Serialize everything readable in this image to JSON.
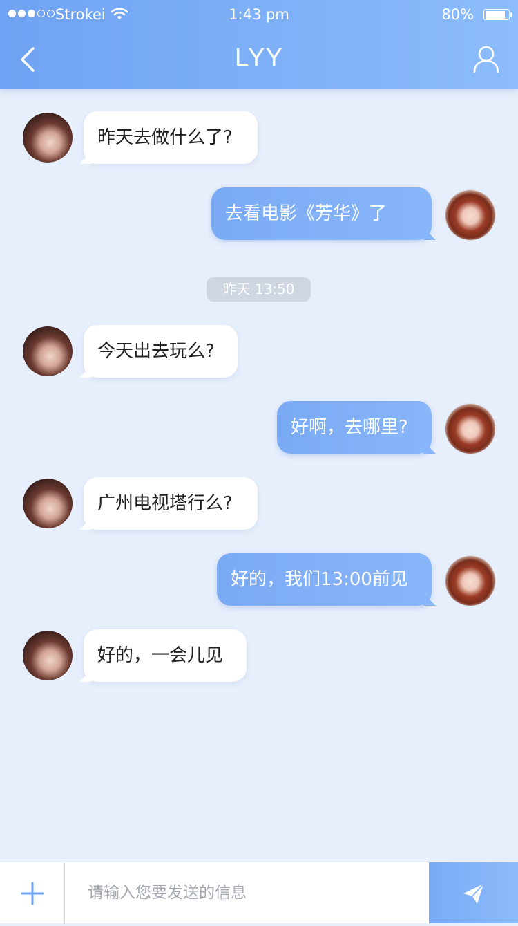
{
  "status_bar": {
    "carrier": "Strokei",
    "time": "1:43 pm",
    "battery": "80%",
    "battery_level": 0.8,
    "signal_bars": 5,
    "signal_filled": 3
  },
  "header": {
    "title": "LYY",
    "back_icon": "chevron-left-icon",
    "profile_icon": "user-icon"
  },
  "messages": [
    {
      "side": "left",
      "text": "昨天去做什么了?"
    },
    {
      "side": "right",
      "text": "去看电影《芳华》了"
    },
    {
      "side": "left",
      "text": "今天出去玩么?"
    },
    {
      "side": "right",
      "text": "好啊，去哪里?"
    },
    {
      "side": "left",
      "text": "广州电视塔行么?"
    },
    {
      "side": "right",
      "text": "好的，我们13:00前见"
    },
    {
      "side": "left",
      "text": "好的，一会儿见"
    }
  ],
  "time_divider": "昨天 13:50",
  "input_bar": {
    "placeholder": "请输入您要发送的信息",
    "value": "",
    "add_icon": "plus-icon",
    "send_icon": "send-icon"
  },
  "colors": {
    "header_start": "#6fa3f3",
    "header_end": "#8cbcfb",
    "background": "#e8effc",
    "outgoing_bubble": "#7aaaf4",
    "incoming_bubble": "#ffffff",
    "accent": "#6fa3f3"
  }
}
